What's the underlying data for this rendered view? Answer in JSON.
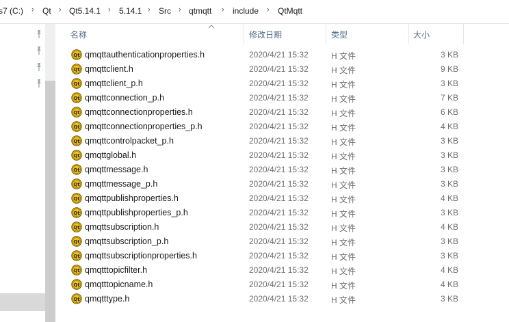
{
  "breadcrumb": [
    "s7 (C:)",
    "Qt",
    "Qt5.14.1",
    "5.14.1",
    "Src",
    "qtmqtt",
    "include",
    "QtMqtt"
  ],
  "separator": "›",
  "columns": {
    "name": "名称",
    "date": "修改日期",
    "type": "类型",
    "size": "大小"
  },
  "accent": "#4d6b8a",
  "files": [
    {
      "name": "qmqttauthenticationproperties.h",
      "date": "2020/4/21 15:32",
      "type": "H 文件",
      "size": "3 KB"
    },
    {
      "name": "qmqttclient.h",
      "date": "2020/4/21 15:32",
      "type": "H 文件",
      "size": "9 KB"
    },
    {
      "name": "qmqttclient_p.h",
      "date": "2020/4/21 15:32",
      "type": "H 文件",
      "size": "3 KB"
    },
    {
      "name": "qmqttconnection_p.h",
      "date": "2020/4/21 15:32",
      "type": "H 文件",
      "size": "7 KB"
    },
    {
      "name": "qmqttconnectionproperties.h",
      "date": "2020/4/21 15:32",
      "type": "H 文件",
      "size": "6 KB"
    },
    {
      "name": "qmqttconnectionproperties_p.h",
      "date": "2020/4/21 15:32",
      "type": "H 文件",
      "size": "4 KB"
    },
    {
      "name": "qmqttcontrolpacket_p.h",
      "date": "2020/4/21 15:32",
      "type": "H 文件",
      "size": "3 KB"
    },
    {
      "name": "qmqttglobal.h",
      "date": "2020/4/21 15:32",
      "type": "H 文件",
      "size": "3 KB"
    },
    {
      "name": "qmqttmessage.h",
      "date": "2020/4/21 15:32",
      "type": "H 文件",
      "size": "3 KB"
    },
    {
      "name": "qmqttmessage_p.h",
      "date": "2020/4/21 15:32",
      "type": "H 文件",
      "size": "3 KB"
    },
    {
      "name": "qmqttpublishproperties.h",
      "date": "2020/4/21 15:32",
      "type": "H 文件",
      "size": "4 KB"
    },
    {
      "name": "qmqttpublishproperties_p.h",
      "date": "2020/4/21 15:32",
      "type": "H 文件",
      "size": "3 KB"
    },
    {
      "name": "qmqttsubscription.h",
      "date": "2020/4/21 15:32",
      "type": "H 文件",
      "size": "4 KB"
    },
    {
      "name": "qmqttsubscription_p.h",
      "date": "2020/4/21 15:32",
      "type": "H 文件",
      "size": "3 KB"
    },
    {
      "name": "qmqttsubscriptionproperties.h",
      "date": "2020/4/21 15:32",
      "type": "H 文件",
      "size": "3 KB"
    },
    {
      "name": "qmqtttopicfilter.h",
      "date": "2020/4/21 15:32",
      "type": "H 文件",
      "size": "4 KB"
    },
    {
      "name": "qmqtttopicname.h",
      "date": "2020/4/21 15:32",
      "type": "H 文件",
      "size": "4 KB"
    },
    {
      "name": "qmqtttype.h",
      "date": "2020/4/21 15:32",
      "type": "H 文件",
      "size": "3 KB"
    }
  ],
  "icons": {
    "file": "qt-header-file-icon",
    "pin": "pin-icon",
    "sort": "sort-ascending-icon"
  }
}
